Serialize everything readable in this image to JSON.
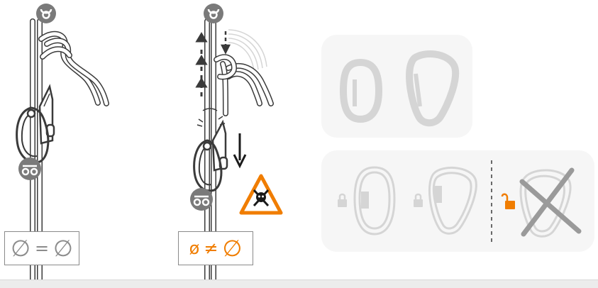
{
  "figure": {
    "left_formula": {
      "left_symbol": "∅",
      "operator": "=",
      "right_symbol": "∅"
    },
    "middle_formula": {
      "left_symbol": "ø",
      "operator": "≠",
      "right_symbol": "∅"
    },
    "icons": {
      "top_badges": "anchor-icon",
      "harness_badges": "harness-icon",
      "warning": "danger-skull-warning-icon",
      "lock": "padlock-closed-icon",
      "unlock": "padlock-open-icon"
    },
    "colors": {
      "accent": "#f07d00",
      "rope_dark": "#3a3a3a",
      "rope_gray": "#8c8c8c",
      "panel_bg": "#f6f6f6",
      "panel_line": "#d5d5d5",
      "badge": "#7a7a7a"
    }
  }
}
